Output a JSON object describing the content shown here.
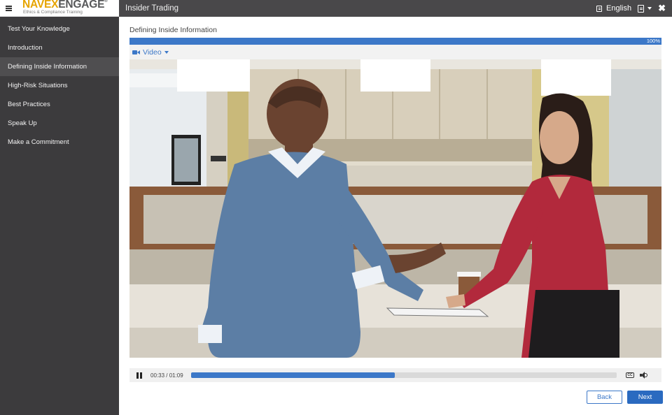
{
  "brand": {
    "logo_part1": "NAVEX",
    "logo_part2": "ENGAGE",
    "logo_tm": "®",
    "tagline": "Ethics & Compliance Training",
    "menu_icon": "hamburger-icon"
  },
  "header": {
    "title": "Insider Trading",
    "language": "English",
    "language_icon": "language-icon",
    "document_icon": "document-icon",
    "close_icon": "close-icon"
  },
  "sidebar": {
    "items": [
      {
        "label": "Test Your Knowledge",
        "active": false
      },
      {
        "label": "Introduction",
        "active": false
      },
      {
        "label": "Defining Inside Information",
        "active": true
      },
      {
        "label": "High-Risk Situations",
        "active": false
      },
      {
        "label": "Best Practices",
        "active": false
      },
      {
        "label": "Speak Up",
        "active": false
      },
      {
        "label": "Make a Commitment",
        "active": false
      }
    ]
  },
  "main": {
    "page_title": "Defining Inside Information",
    "progress": {
      "percent": 100,
      "label": "100%"
    },
    "media_tab": {
      "label": "Video",
      "icon": "video-camera-icon"
    },
    "player": {
      "time": "00:33 / 01:09",
      "played_fraction": 0.478,
      "pause_icon": "pause-icon",
      "cc_label": "CC",
      "cc_icon": "closed-captions-icon",
      "volume_icon": "volume-icon"
    },
    "nav": {
      "back_label": "Back",
      "next_label": "Next"
    }
  },
  "colors": {
    "accent": "#3c78c8",
    "header_bg": "#49484a",
    "sidebar_bg": "#3c3b3d",
    "sidebar_active_bg": "#4f4e50",
    "logo_yellow": "#e6a400"
  }
}
